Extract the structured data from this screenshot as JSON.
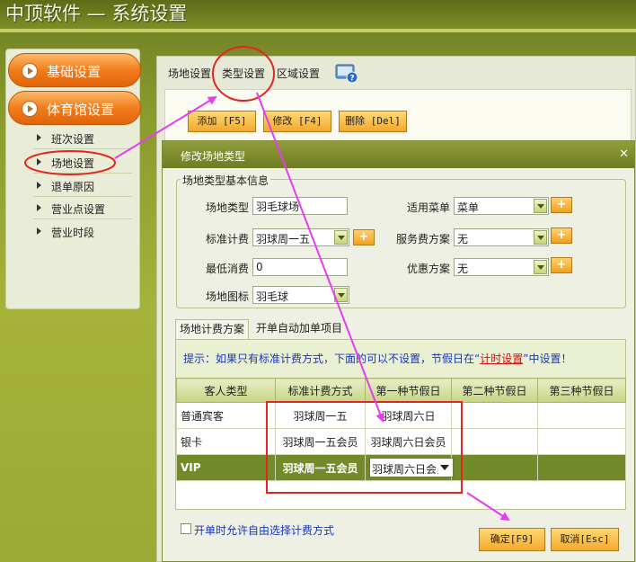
{
  "app": {
    "title": "中顶软件 — 系统设置"
  },
  "sidebar": {
    "categories": [
      {
        "label": "基础设置"
      },
      {
        "label": "体育馆设置"
      }
    ],
    "items": [
      {
        "label": "班次设置"
      },
      {
        "label": "场地设置"
      },
      {
        "label": "退单原因"
      },
      {
        "label": "营业点设置"
      },
      {
        "label": "营业时段"
      }
    ]
  },
  "tabs": [
    {
      "label": "场地设置"
    },
    {
      "label": "类型设置"
    },
    {
      "label": "区域设置"
    }
  ],
  "toolbar": {
    "add": "添加 [F5]",
    "edit": "修改 [F4]",
    "delete": "删除 [Del]"
  },
  "dialog": {
    "title": "修改场地类型",
    "close": "✕",
    "group_title": "场地类型基本信息",
    "fields": {
      "venue_type_label": "场地类型",
      "venue_type_value": "羽毛球场",
      "std_billing_label": "标准计费",
      "std_billing_value": "羽球周一五",
      "min_charge_label": "最低消费",
      "min_charge_value": "0",
      "venue_icon_label": "场地图标",
      "venue_icon_value": "羽毛球",
      "menu_label": "适用菜单",
      "menu_value": "菜单",
      "service_fee_label": "服务费方案",
      "service_fee_value": "无",
      "discount_label": "优惠方案",
      "discount_value": "无",
      "plus": "+"
    },
    "subtabs": [
      {
        "label": "场地计费方案"
      },
      {
        "label": "开单自动加单项目"
      }
    ],
    "tip": {
      "prefix": "提示：如果只有标准计费方式，下面的可以不设置，节假日在“",
      "link": "计时设置",
      "suffix": "”中设置！"
    },
    "table": {
      "columns": [
        "客人类型",
        "标准计费方式",
        "第一种节假日",
        "第二种节假日",
        "第三种节假日"
      ],
      "rows": [
        [
          "普通宾客",
          "羽球周一五",
          "羽球周六日",
          "",
          ""
        ],
        [
          "银卡",
          "羽球周一五会员",
          "羽球周六日会员",
          "",
          ""
        ],
        [
          "VIP",
          "羽球周一五会员",
          "羽球周六日会员",
          "",
          ""
        ]
      ]
    },
    "checkbox_label": "开单时允许自由选择计费方式",
    "ok": "确定[F9]",
    "cancel": "取消[Esc]"
  },
  "colors": {
    "accent_orange": "#f17d1c",
    "annotation_magenta": "#e63cf0",
    "annotation_red": "#e0261f"
  }
}
